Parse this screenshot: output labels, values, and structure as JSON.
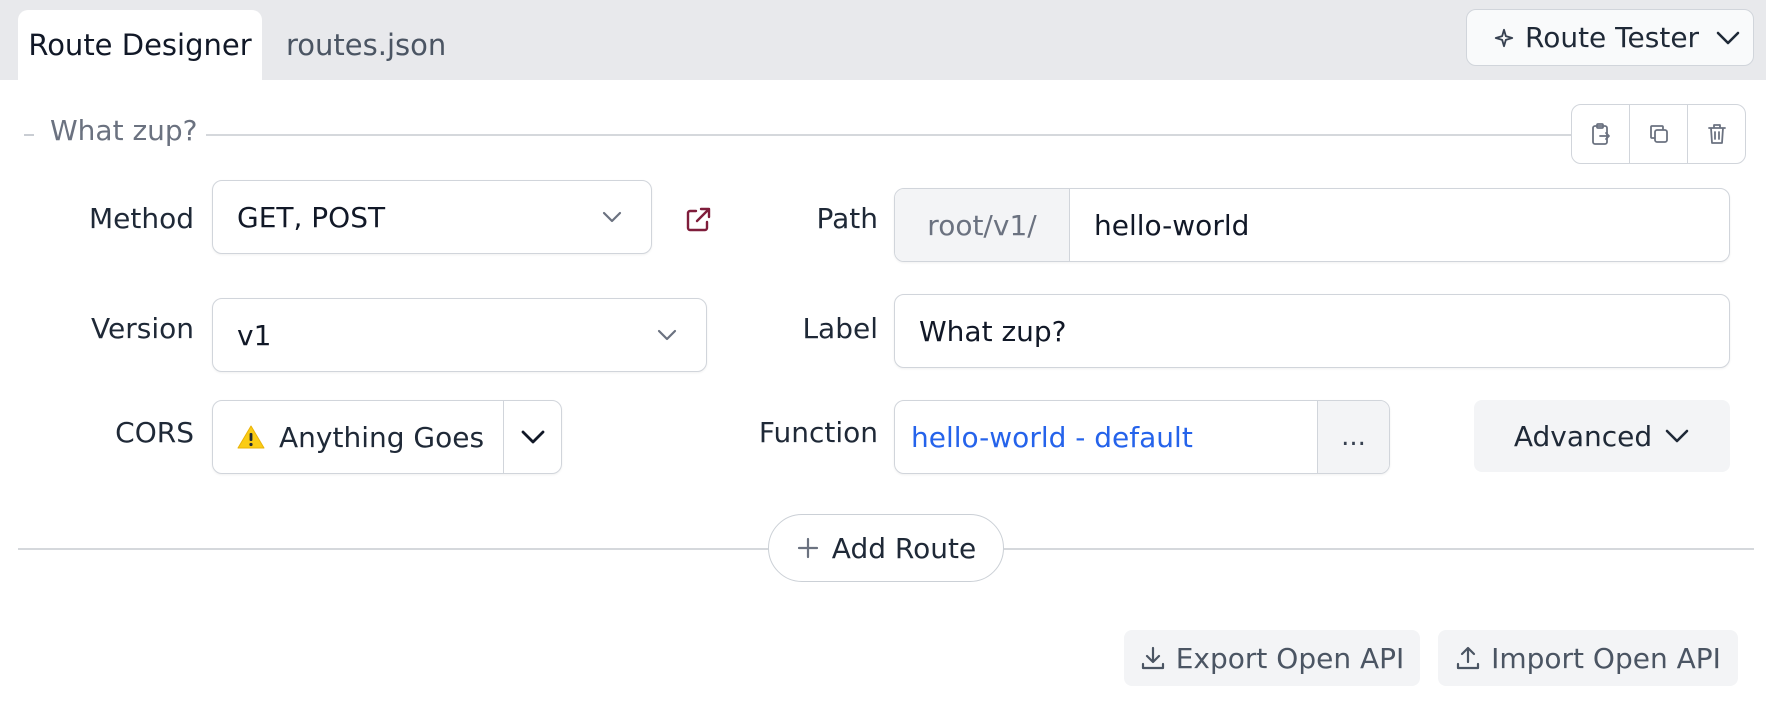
{
  "tabs": [
    {
      "label": "Route Designer",
      "active": true
    },
    {
      "label": "routes.json",
      "active": false
    }
  ],
  "tester": {
    "label": "Route Tester",
    "icon": "sparkle-icon"
  },
  "group": {
    "title": "What zup?",
    "actions": [
      {
        "icon": "clipboard-copy-icon"
      },
      {
        "icon": "duplicate-icon"
      },
      {
        "icon": "trash-icon"
      }
    ]
  },
  "form": {
    "method": {
      "label": "Method",
      "value": "GET, POST"
    },
    "path": {
      "label": "Path",
      "prefix": "root/v1/",
      "value": "hello-world"
    },
    "version": {
      "label": "Version",
      "value": "v1"
    },
    "route_label": {
      "label": "Label",
      "value": "What zup?"
    },
    "cors": {
      "label": "CORS",
      "value": "Anything Goes",
      "icon": "warning-icon"
    },
    "function": {
      "label": "Function",
      "value": "hello-world - default",
      "more": "..."
    },
    "advanced": {
      "label": "Advanced"
    }
  },
  "add_route": {
    "label": "Add Route"
  },
  "bottom": {
    "export": {
      "label": "Export Open API",
      "icon": "download-icon"
    },
    "import": {
      "label": "Import Open API",
      "icon": "upload-icon"
    }
  },
  "colors": {
    "link": "#2563eb",
    "external_link": "#7f1d3b",
    "warning": "#facc15",
    "tabbar_bg": "#e8e9ec"
  }
}
